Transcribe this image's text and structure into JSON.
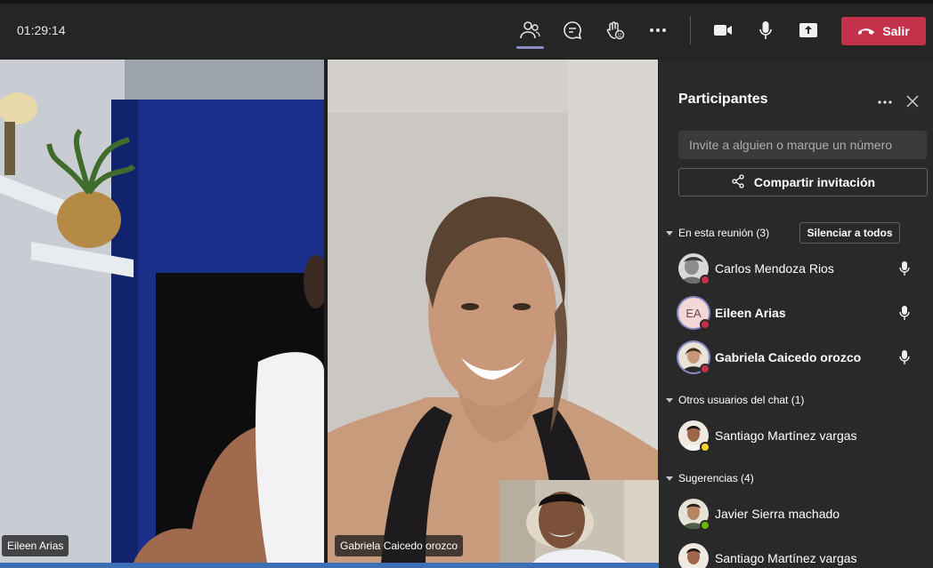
{
  "meeting": {
    "timer": "01:29:14"
  },
  "toolbar": {
    "participants_icon": "people-icon",
    "chat_icon": "chat-icon",
    "reactions_icon": "raise-hand-icon",
    "more_icon": "more-icon",
    "camera_icon": "camera-icon",
    "mic_icon": "microphone-icon",
    "share_icon": "share-screen-icon",
    "leave_label": "Salir",
    "leave_color": "#c4314b",
    "accent": "#8b8cc7"
  },
  "videos": {
    "left_name": "Eileen Arias",
    "right_name": "Gabriela Caicedo orozco"
  },
  "panel": {
    "title": "Participantes",
    "invite_placeholder": "Invite a alguien o marque un número",
    "share_label": "Compartir invitación",
    "in_meeting_label": "En esta reunión (3)",
    "mute_all_label": "Silenciar a todos",
    "in_meeting": [
      {
        "name": "Carlos Mendoza Rios",
        "status": "busy"
      },
      {
        "name": "Eileen Arias",
        "initials": "EA",
        "status": "busy"
      },
      {
        "name": "Gabriela Caicedo orozco",
        "status": "busy"
      }
    ],
    "chat_users_label": "Otros usuarios del chat (1)",
    "chat_users": [
      {
        "name": "Santiago Martínez vargas",
        "status": "away"
      }
    ],
    "suggestions_label": "Sugerencias (4)",
    "suggestions": [
      {
        "name": "Javier Sierra machado",
        "status": "available"
      },
      {
        "name": "Santiago Martínez vargas",
        "status": "none"
      }
    ]
  }
}
